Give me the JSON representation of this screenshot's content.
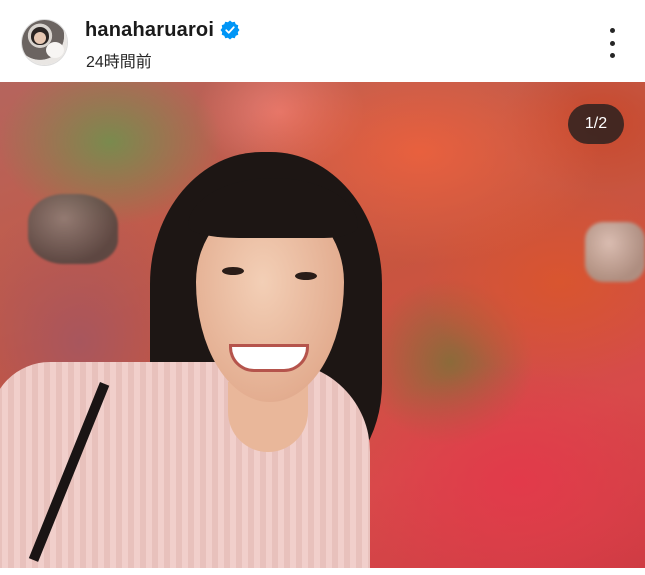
{
  "post": {
    "username": "hanaharuaroi",
    "verified": true,
    "timestamp": "24時間前",
    "image_counter": "1/2"
  },
  "icons": {
    "verified": "verified-badge-icon",
    "more": "more-options-icon"
  },
  "colors": {
    "verified_blue": "#0095f6",
    "text": "#1a1a1a"
  }
}
